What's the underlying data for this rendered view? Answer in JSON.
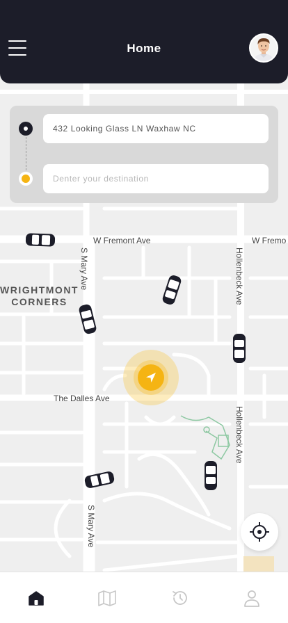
{
  "header": {
    "title": "Home"
  },
  "route": {
    "pickup_value": "432 Looking Glass LN Waxhaw NC",
    "destination_placeholder": "Denter your destination"
  },
  "map": {
    "streets": {
      "fremont_left": "W Fremont Ave",
      "fremont_right": "W Fremo",
      "dalles": "The Dalles Ave",
      "mary_top": "S Mary Ave",
      "mary_bottom": "S Mary Ave",
      "hollenbeck_top": "Hollenbeck Ave",
      "hollenbeck_bottom": "Hollenbeck Ave"
    },
    "area": {
      "line1": "WRIGHTMONT",
      "line2": "CORNERS"
    }
  },
  "bottom_nav": {
    "items": [
      {
        "name": "home",
        "icon": "home-icon",
        "active": true
      },
      {
        "name": "map",
        "icon": "map-icon",
        "active": false
      },
      {
        "name": "history",
        "icon": "history-icon",
        "active": false
      },
      {
        "name": "profile",
        "icon": "profile-icon",
        "active": false
      }
    ]
  },
  "colors": {
    "header_bg": "#1c1d29",
    "accent": "#f5b413",
    "map_bg": "#efefef",
    "road": "#ffffff"
  }
}
